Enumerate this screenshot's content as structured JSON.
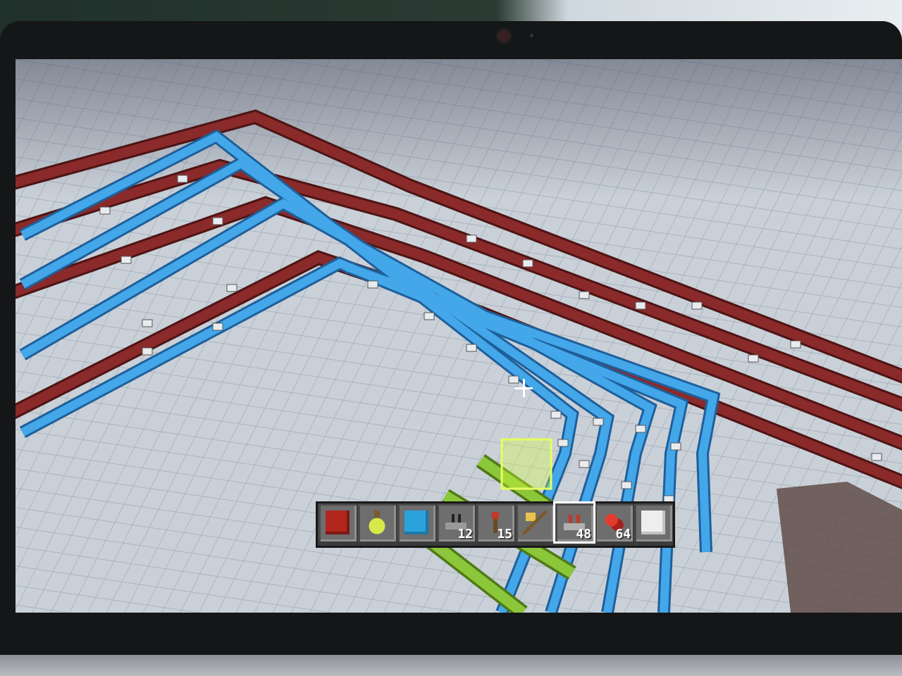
{
  "game": {
    "crosshair": "crosshair-plus",
    "colors": {
      "ground": "#cdd3da",
      "redstone_line": "#7a2424",
      "blue_line": "#3a9be0",
      "lime_line": "#86c232"
    }
  },
  "hotbar": {
    "selected_index": 6,
    "slots": [
      {
        "item": "red-concrete-icon",
        "count": ""
      },
      {
        "item": "potion-bottle-icon",
        "count": ""
      },
      {
        "item": "light-blue-concrete-icon",
        "count": ""
      },
      {
        "item": "redstone-repeater-icon",
        "count": "12"
      },
      {
        "item": "redstone-torch-icon",
        "count": "15"
      },
      {
        "item": "golden-axe-icon",
        "count": ""
      },
      {
        "item": "redstone-comparator-icon",
        "count": "48"
      },
      {
        "item": "redstone-dust-icon",
        "count": "64"
      },
      {
        "item": "white-concrete-icon",
        "count": ""
      }
    ]
  }
}
